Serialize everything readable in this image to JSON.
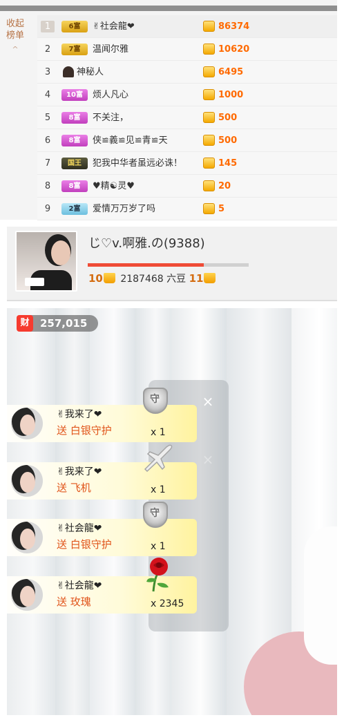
{
  "ranking": {
    "collapse_label_1": "收起",
    "collapse_label_2": "榜单",
    "collapse_arrow": "^",
    "rows": [
      {
        "rank": "1",
        "badge": "6富",
        "badge_color": "#d9a013",
        "name": "✌社会龍❤",
        "value": "86374"
      },
      {
        "rank": "2",
        "badge": "7富",
        "badge_color": "#d9a013",
        "name": "温闻尔雅",
        "value": "10620"
      },
      {
        "rank": "3",
        "badge": "",
        "badge_color": "#3b2e28",
        "name": "神秘人",
        "value": "6495"
      },
      {
        "rank": "4",
        "badge": "10富",
        "badge_color": "#c13fbd",
        "name": "烦人凡心",
        "value": "1000"
      },
      {
        "rank": "5",
        "badge": "8富",
        "badge_color": "#c13fbd",
        "name": "不关注，",
        "value": "500"
      },
      {
        "rank": "6",
        "badge": "8富",
        "badge_color": "#c13fbd",
        "name": "侠≌義≌见≌青≌天",
        "value": "500"
      },
      {
        "rank": "7",
        "badge": "国王",
        "badge_color": "#2f2f20",
        "name": "犯我中华者虽远必诛！",
        "value": "145"
      },
      {
        "rank": "8",
        "badge": "8富",
        "badge_color": "#c13fbd",
        "name": "♥精☯灵♥",
        "value": "20"
      },
      {
        "rank": "9",
        "badge": "2富",
        "badge_color": "#6dbfdf",
        "name": "爱情万万岁了吗",
        "value": "5"
      }
    ]
  },
  "anchor": {
    "name": "じ♡v.啊雅.の(9388)",
    "current_level": "10",
    "beans": "2187468 六豆",
    "next_level": "11",
    "progress": 0.72,
    "accent_color": "#ef4b36"
  },
  "stream": {
    "fortune_icon": "财",
    "fortune_value": "257,015",
    "gift_close": "×",
    "gifts": [
      {
        "user": "✌我来了❤",
        "action": "送 白银守护",
        "count": "x 1",
        "icon": "silver-guard-icon"
      },
      {
        "user": "✌我来了❤",
        "action": "送 飞机",
        "count": "x 1",
        "icon": "airplane-icon"
      },
      {
        "user": "✌社会龍❤",
        "action": "送 白银守护",
        "count": "x 1",
        "icon": "silver-guard-icon"
      },
      {
        "user": "✌社会龍❤",
        "action": "送 玫瑰",
        "count": "x 2345",
        "icon": "rose-icon"
      }
    ]
  }
}
